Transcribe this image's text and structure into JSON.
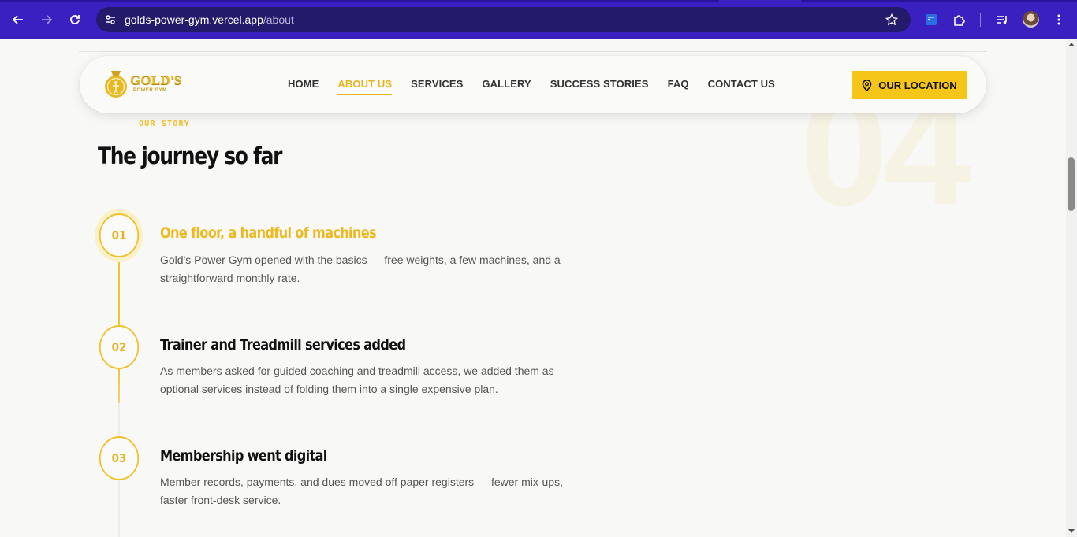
{
  "browser": {
    "url_host": "golds-power-gym.vercel.app",
    "url_path": "/about"
  },
  "nav": {
    "logo_word": "GOLD'S",
    "logo_tag": "POWER GYM",
    "links": [
      "HOME",
      "ABOUT US",
      "SERVICES",
      "GALLERY",
      "SUCCESS STORIES",
      "FAQ",
      "CONTACT US"
    ],
    "active_link": "ABOUT US",
    "location_button": "OUR LOCATION"
  },
  "section": {
    "eyebrow": "OUR STORY",
    "heading": "The journey so far",
    "background_number": "04"
  },
  "timeline": [
    {
      "number": "01",
      "title": "One floor, a handful of machines",
      "description": "Gold's Power Gym opened with the basics — free weights, a few machines, and a straightforward monthly rate.",
      "active": true
    },
    {
      "number": "02",
      "title": "Trainer and Treadmill services added",
      "description": "As members asked for guided coaching and treadmill access, we added them as optional services instead of folding them into a single expensive plan.",
      "active": false
    },
    {
      "number": "03",
      "title": "Membership went digital",
      "description": "Member records, payments, and dues moved off paper registers — fewer mix-ups, faster front-desk service.",
      "active": false
    }
  ],
  "colors": {
    "accent": "#f5c518",
    "browser_bar": "#3a1fc1"
  }
}
